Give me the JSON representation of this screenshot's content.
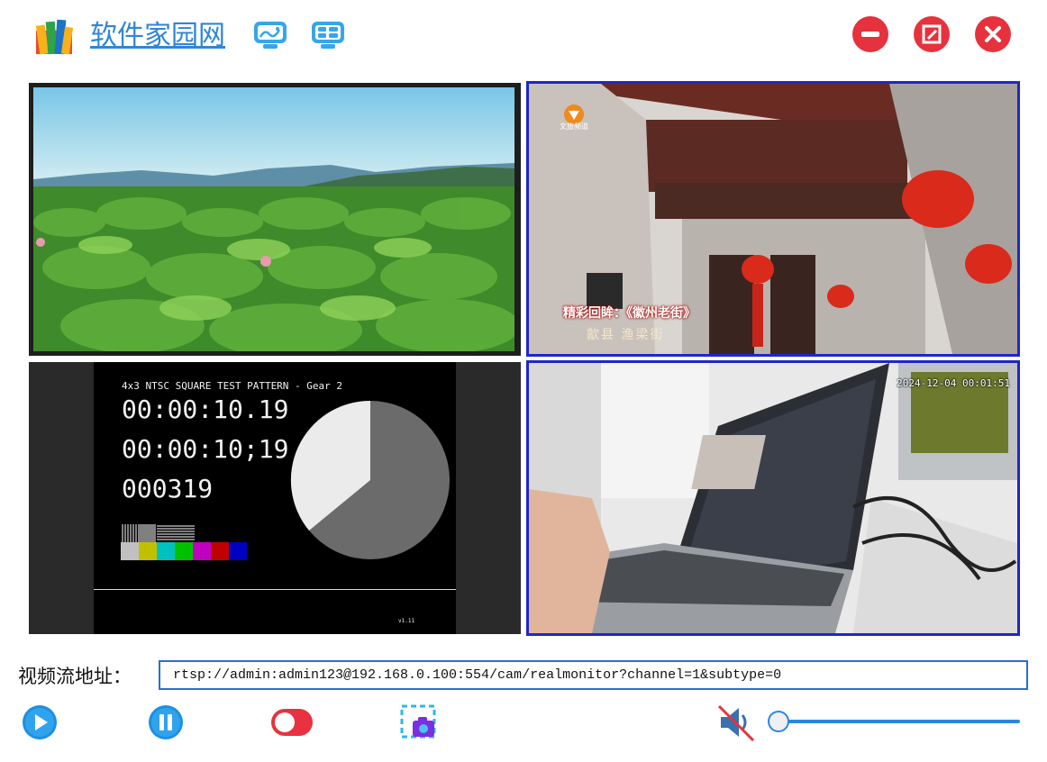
{
  "app": {
    "title": "软件家园网",
    "icons": [
      "logo-icon",
      "monitor-signal-icon",
      "monitor-grid-icon"
    ],
    "window_buttons": [
      "minimize-icon",
      "maximize-icon",
      "close-icon"
    ],
    "accent_color": "#2f86d6",
    "window_button_color": "#e6323d"
  },
  "panes": [
    {
      "name": "lotus-landscape",
      "selected": false
    },
    {
      "name": "tv-broadcast",
      "selected": true,
      "channel_logo_text": "文旅频道",
      "caption_line1": "精彩回眸：《徽州老街》",
      "caption_line2": "歙县 渔梁街"
    },
    {
      "name": "ntsc-test-pattern",
      "selected": false,
      "header": "4x3 NTSC SQUARE TEST PATTERN - Gear 2",
      "timecode_1": "00:00:10.19",
      "timecode_2": "00:00:10;19",
      "frame_count": "000319",
      "version": "v1.11",
      "color_bars": [
        "#c0c0c0",
        "#c0c000",
        "#00c0c0",
        "#00c000",
        "#c000c0",
        "#c00000",
        "#0000c0"
      ]
    },
    {
      "name": "camera-feed",
      "selected": true,
      "timestamp": "2024-12-04 00:01:51"
    }
  ],
  "stream": {
    "label": "视频流地址：",
    "url": "rtsp://admin:admin123@192.168.0.100:554/cam/realmonitor?channel=1&subtype=0"
  },
  "controls": {
    "icons": [
      "play-icon",
      "pause-icon",
      "record-toggle-icon",
      "snapshot-icon",
      "mute-icon"
    ],
    "volume": 0.0,
    "selected_border_color": "#1f27c7"
  }
}
